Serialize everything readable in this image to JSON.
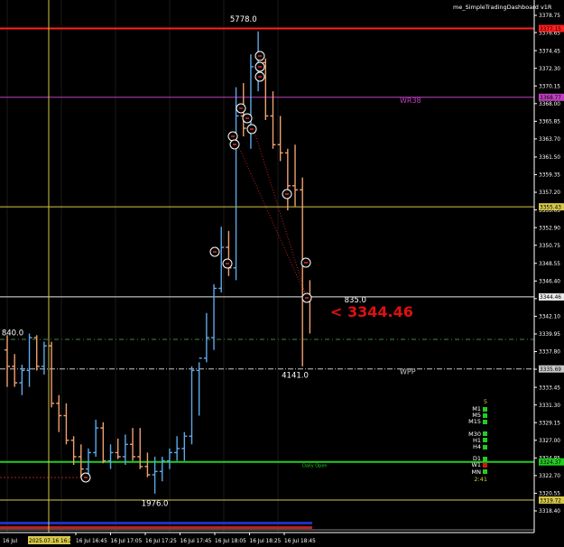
{
  "window_title": "me_SimpleTradingDashboard v1R",
  "price_ticks": [
    "3378.75",
    "3376.65",
    "3374.45",
    "3372.30",
    "3370.15",
    "3368.00",
    "3365.85",
    "3363.70",
    "3361.50",
    "3359.35",
    "3357.20",
    "3355.05",
    "3352.90",
    "3350.75",
    "3348.55",
    "3346.40",
    "3344.25",
    "3342.10",
    "3339.95",
    "3337.80",
    "3335.65",
    "3333.45",
    "3331.30",
    "3329.15",
    "3327.00",
    "3324.85",
    "3322.70",
    "3320.55",
    "3318.40"
  ],
  "time_ticks": [
    "16 Jul 16:45",
    "16 Jul 17:05",
    "16 Jul 17:25",
    "16 Jul 17:45",
    "16 Jul 18:05",
    "16 Jul 18:25",
    "16 Jul 18:45"
  ],
  "cursor_time": "2025.07.16 16:20",
  "level_lines": [
    {
      "price": 3377.15,
      "price_label": "3377.15",
      "color": "#ff2020"
    },
    {
      "price": 3368.77,
      "price_label": "3368.77",
      "color": "#c040c0",
      "name": "WR38"
    },
    {
      "price": 3355.43,
      "price_label": "3355.43",
      "color": "#d6c84a"
    },
    {
      "price": 3344.46,
      "price_label": "3344.46",
      "color": "#e8e8e8"
    },
    {
      "price": 3335.69,
      "price_label": "3335.69",
      "color": "#c8c8c8",
      "name": "WPP"
    },
    {
      "price": 3324.37,
      "price_label": "3324.37",
      "color": "#22cc22",
      "name": "Daily Open"
    },
    {
      "price": 3319.72,
      "price_label": "3319.72",
      "color": "#d6c84a"
    }
  ],
  "current_price": "3344.46",
  "volume_labels": [
    {
      "text": "5778.0",
      "bar": 32,
      "price": 3378.0
    },
    {
      "text": "840.0",
      "bar": 0,
      "price": 3339.8
    },
    {
      "text": "835.0",
      "bar": 43,
      "price": 3343.8
    },
    {
      "text": "4141.0",
      "bar": 39,
      "price": 3334.6
    },
    {
      "text": "1976.0",
      "bar": 20,
      "price": 3319.0
    }
  ],
  "dashboard": {
    "count": "5",
    "groups": [
      [
        {
          "label": "M1",
          "color": "#22cc22"
        },
        {
          "label": "M5",
          "color": "#22cc22"
        },
        {
          "label": "M15",
          "color": "#22cc22"
        }
      ],
      [
        {
          "label": "M30",
          "color": "#22cc22"
        },
        {
          "label": "H1",
          "color": "#22cc22"
        },
        {
          "label": "H4",
          "color": "#22cc22"
        }
      ],
      [
        {
          "label": "D1",
          "color": "#22cc22"
        },
        {
          "label": "W1",
          "color": "#e01010"
        },
        {
          "label": "MN",
          "color": "#22cc22"
        }
      ]
    ],
    "countdown": "2:41"
  },
  "colors": {
    "bull": "#5fa8e8",
    "bear": "#f0a070",
    "grid": "#333333",
    "axis": "#ffffff"
  },
  "chart_data": {
    "type": "ohlc",
    "symbol_timeframe": "M5",
    "bars": [
      {
        "o": 3338,
        "h": 3339.8,
        "l": 3333.5,
        "c": 3336
      },
      {
        "o": 3336,
        "h": 3337.5,
        "l": 3333.5,
        "c": 3334
      },
      {
        "o": 3334,
        "h": 3336.2,
        "l": 3332.5,
        "c": 3335.5
      },
      {
        "o": 3335.5,
        "h": 3340,
        "l": 3333.5,
        "c": 3339.5
      },
      {
        "o": 3339.5,
        "h": 3339.8,
        "l": 3335.5,
        "c": 3336
      },
      {
        "o": 3336,
        "h": 3339,
        "l": 3335,
        "c": 3338.5
      },
      {
        "o": 3338.5,
        "h": 3339,
        "l": 3331,
        "c": 3331.5
      },
      {
        "o": 3331.5,
        "h": 3332.5,
        "l": 3328,
        "c": 3330
      },
      {
        "o": 3330,
        "h": 3331.5,
        "l": 3326.5,
        "c": 3327
      },
      {
        "o": 3327,
        "h": 3327.5,
        "l": 3324,
        "c": 3325
      },
      {
        "o": 3325,
        "h": 3326.5,
        "l": 3322.5,
        "c": 3323.5
      },
      {
        "o": 3323.5,
        "h": 3326,
        "l": 3322.5,
        "c": 3325.5
      },
      {
        "o": 3325.5,
        "h": 3329.5,
        "l": 3325,
        "c": 3328.5
      },
      {
        "o": 3328.5,
        "h": 3329.2,
        "l": 3324.2,
        "c": 3324.5
      },
      {
        "o": 3324.5,
        "h": 3326.5,
        "l": 3323.5,
        "c": 3325.5
      },
      {
        "o": 3325.5,
        "h": 3327.2,
        "l": 3324.7,
        "c": 3325
      },
      {
        "o": 3325,
        "h": 3327.7,
        "l": 3324,
        "c": 3326.5
      },
      {
        "o": 3326.5,
        "h": 3328.5,
        "l": 3324.5,
        "c": 3325
      },
      {
        "o": 3325,
        "h": 3328.5,
        "l": 3323.5,
        "c": 3323.8
      },
      {
        "o": 3323.8,
        "h": 3325.5,
        "l": 3322.5,
        "c": 3322.8
      },
      {
        "o": 3322.8,
        "h": 3325,
        "l": 3320.5,
        "c": 3323.2
      },
      {
        "o": 3323.2,
        "h": 3325,
        "l": 3322,
        "c": 3324.5
      },
      {
        "o": 3324.5,
        "h": 3326,
        "l": 3323.5,
        "c": 3325.5
      },
      {
        "o": 3325.5,
        "h": 3327.5,
        "l": 3324.5,
        "c": 3326
      },
      {
        "o": 3326,
        "h": 3328,
        "l": 3324.5,
        "c": 3327.5
      },
      {
        "o": 3327.5,
        "h": 3336,
        "l": 3326.5,
        "c": 3335.5
      },
      {
        "o": 3335.5,
        "h": 3336.5,
        "l": 3330,
        "c": 3337
      },
      {
        "o": 3337,
        "h": 3342.5,
        "l": 3336.5,
        "c": 3339.5
      },
      {
        "o": 3339.5,
        "h": 3346,
        "l": 3338,
        "c": 3345.5
      },
      {
        "o": 3345.5,
        "h": 3353,
        "l": 3345,
        "c": 3350.5
      },
      {
        "o": 3350.5,
        "h": 3352.5,
        "l": 3347,
        "c": 3348
      },
      {
        "o": 3348,
        "h": 3370,
        "l": 3346.5,
        "c": 3366.5
      },
      {
        "o": 3366.5,
        "h": 3370.5,
        "l": 3364,
        "c": 3365
      },
      {
        "o": 3365,
        "h": 3374,
        "l": 3362.5,
        "c": 3372.5
      },
      {
        "o": 3372.5,
        "h": 3376.8,
        "l": 3369.5,
        "c": 3373
      },
      {
        "o": 3373,
        "h": 3373.5,
        "l": 3366,
        "c": 3366.5
      },
      {
        "o": 3366.5,
        "h": 3369.5,
        "l": 3362.5,
        "c": 3363
      },
      {
        "o": 3363,
        "h": 3366.5,
        "l": 3361,
        "c": 3362
      },
      {
        "o": 3362,
        "h": 3362.5,
        "l": 3355,
        "c": 3358
      },
      {
        "o": 3358,
        "h": 3363,
        "l": 3355.5,
        "c": 3357.5
      },
      {
        "o": 3357.5,
        "h": 3359,
        "l": 3336,
        "c": 3344.5
      },
      {
        "o": 3344.5,
        "h": 3346.5,
        "l": 3340,
        "c": 3344.46
      }
    ],
    "ylim": [
      3317.3,
      3379.8
    ]
  }
}
